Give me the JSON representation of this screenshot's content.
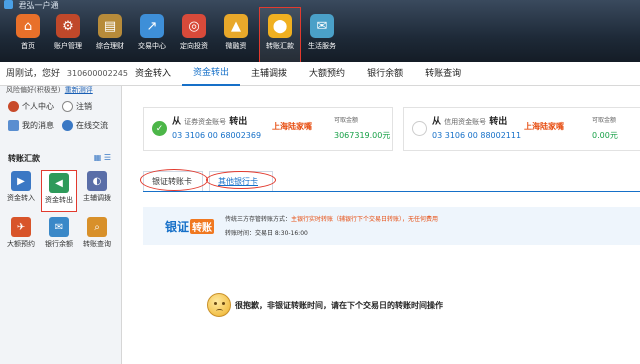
{
  "window": {
    "title": "君弘一户通"
  },
  "toolbar": {
    "items": [
      {
        "label": "首页",
        "icon": "home-icon",
        "color": "#e8702a"
      },
      {
        "label": "账户管理",
        "icon": "account-icon",
        "color": "#c0482a"
      },
      {
        "label": "综合理财",
        "icon": "finance-icon",
        "color": "#b78b3a"
      },
      {
        "label": "交易中心",
        "icon": "trade-chart-icon",
        "color": "#3e8fd8"
      },
      {
        "label": "定向投资",
        "icon": "target-icon",
        "color": "#d84a3a"
      },
      {
        "label": "微融资",
        "icon": "loan-icon",
        "color": "#e8a82a"
      },
      {
        "label": "转账汇款",
        "icon": "transfer-icon",
        "color": "#f0b020"
      },
      {
        "label": "生活服务",
        "icon": "life-service-icon",
        "color": "#4aa0c8"
      }
    ],
    "active_index": 6
  },
  "user": {
    "greeting": "周刚试，您好",
    "id": "310600002245",
    "risk_label": "风险偏好(积极型)",
    "risk_link": "重新测评"
  },
  "top_tabs": [
    "资金转入",
    "资金转出",
    "主辅调拨",
    "大额预约",
    "银行余额",
    "转账查询"
  ],
  "top_tabs_active": 1,
  "sidebar": {
    "row1": [
      {
        "label": "个人中心",
        "icon": "person-icon"
      },
      {
        "label": "注销",
        "icon": "logout-icon"
      }
    ],
    "row2": [
      {
        "label": "我的消息",
        "icon": "message-icon"
      },
      {
        "label": "在线交流",
        "icon": "chat-icon"
      }
    ],
    "section_title": "转账汇款",
    "items": [
      {
        "label": "资金转入",
        "icon": "transfer-in-icon",
        "color": "#3b78c4"
      },
      {
        "label": "资金转出",
        "icon": "transfer-out-icon",
        "color": "#2e9a5a"
      },
      {
        "label": "主辅调拨",
        "icon": "allot-icon",
        "color": "#5a6ea8"
      },
      {
        "label": "大额预约",
        "icon": "reserve-icon",
        "color": "#d8542a"
      },
      {
        "label": "银行余额",
        "icon": "bank-balance-icon",
        "color": "#3a88c8"
      },
      {
        "label": "转账查询",
        "icon": "query-icon",
        "color": "#d8902a"
      }
    ],
    "active_index": 1
  },
  "from_account": {
    "prefix": "从",
    "type": "证券资金账号",
    "action": "转出",
    "number": "03 3106 00 68002369",
    "bank": "上海陆家嘴",
    "balance_label": "可取金额",
    "balance": "3067319.00元",
    "check_color": "#4cb648"
  },
  "credit_account": {
    "prefix": "从",
    "type": "信用资金账号",
    "action": "转出",
    "number": "03 3106 00 88002111",
    "bank": "上海陆家嘴",
    "balance_label": "可取金额",
    "balance": "0.00元"
  },
  "sub_tabs": [
    "银证转账卡",
    "其他银行卡"
  ],
  "notice": {
    "logo_text": "银证",
    "logo_badge": "转账",
    "line1_prefix": "传统三方存管转账方式：",
    "line1_highlight": "主银行实时转账（辅银行下个交易日转账），无任何费用",
    "line2": "转账时间：交易日 8:30-16:00"
  },
  "message": "很抱歉，非银证转账时间，请在下个交易日的转账时间操作"
}
